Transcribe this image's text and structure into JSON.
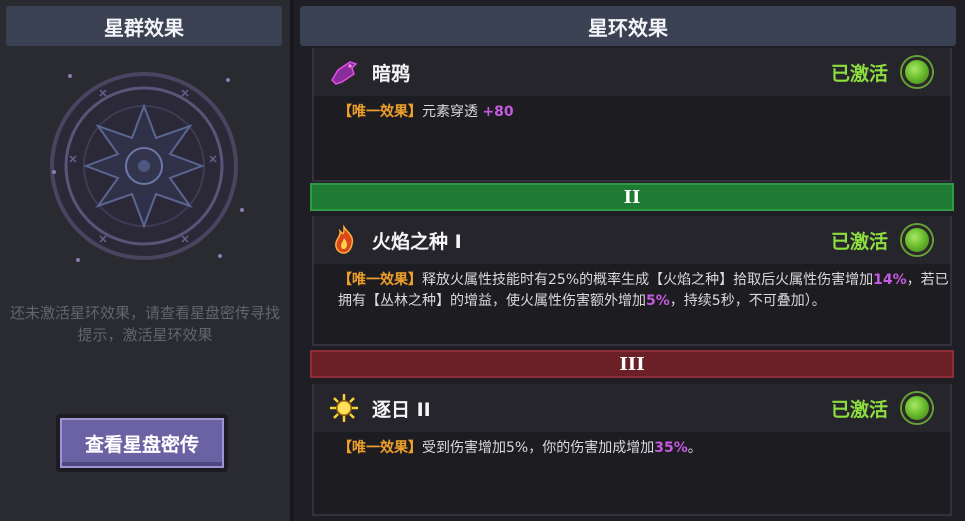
{
  "left": {
    "title": "星群效果",
    "hint": "还未激活星环效果，请查看星盘密传寻找提示，激活星环效果",
    "button_label": "查看星盘密传"
  },
  "right": {
    "title": "星环效果",
    "tiers": [
      {
        "label": "II",
        "color": "#1f7a34"
      },
      {
        "label": "III",
        "color": "#6b1f27"
      }
    ],
    "effects": [
      {
        "name": "暗鸦",
        "icon": "raven-icon",
        "status": "已激活",
        "tag": "【唯一效果】",
        "desc_parts": [
          "元素穿透 ",
          "+80"
        ]
      },
      {
        "name": "火焰之种 I",
        "icon": "fire-seed-icon",
        "status": "已激活",
        "tag": "【唯一效果】",
        "desc_parts": [
          "释放火属性技能时有25%的概率生成【火焰之种】拾取后火属性伤害增加",
          "14%",
          "，若已拥有【丛林之种】的增益，使火属性伤害额外增加",
          "5%",
          "，持续5秒，不可叠加）。"
        ]
      },
      {
        "name": "逐日 II",
        "icon": "sun-icon",
        "status": "已激活",
        "tag": "【唯一效果】",
        "desc_parts": [
          "受到伤害增加5%，你的伤害加成增加",
          "35%",
          "。"
        ]
      }
    ]
  },
  "colors": {
    "active_status": "#8ddf3f",
    "tag": "#f0a12c",
    "highlight": "#c45adf",
    "button": "#6b62a3"
  }
}
